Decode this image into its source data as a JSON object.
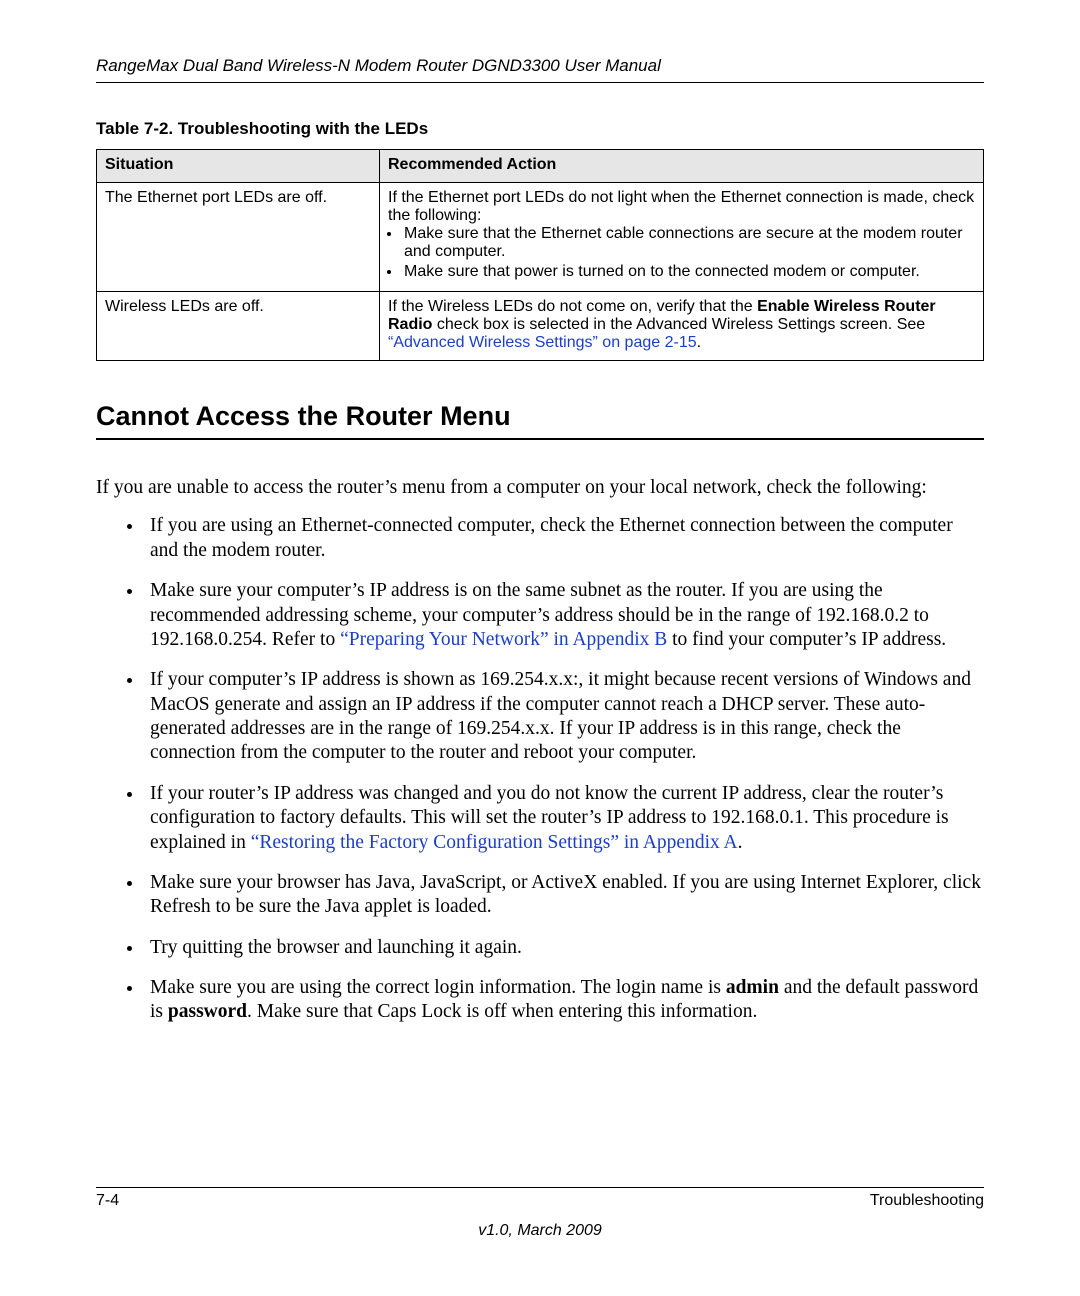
{
  "header": {
    "running_head": "RangeMax Dual Band Wireless-N Modem Router DGND3300 User Manual"
  },
  "table": {
    "caption": "Table 7-2.   Troubleshooting with the LEDs",
    "col1": "Situation",
    "col2": "Recommended Action",
    "rows": [
      {
        "situation": "The Ethernet port LEDs are off.",
        "action_intro": "If the Ethernet port LEDs do not light when the Ethernet connection is made, check the following:",
        "bullets": [
          "Make sure that the Ethernet cable connections are secure at the modem router and computer.",
          "Make sure that power is turned on to the connected modem or computer."
        ]
      },
      {
        "situation": "Wireless LEDs are off.",
        "action_pre": "If the Wireless LEDs do not come on, verify that the ",
        "action_bold": "Enable Wireless Router Radio",
        "action_mid": " check box is selected in the Advanced Wireless Settings screen. See ",
        "action_link": "“Advanced Wireless Settings” on page 2-15",
        "action_end": "."
      }
    ]
  },
  "section": {
    "heading": "Cannot Access the Router Menu",
    "intro": "If you are unable to access the router’s menu from a computer on your local network, check the following:",
    "items": [
      {
        "text": "If you are using an Ethernet-connected computer, check the Ethernet connection between the computer and the modem router."
      },
      {
        "pre": "Make sure your computer’s IP address is on the same subnet as the router. If you are using the recommended addressing scheme, your computer’s address should be in the range of 192.168.0.2 to 192.168.0.254. Refer to ",
        "link": "“Preparing Your Network” in Appendix B",
        "post": " to find your computer’s IP address."
      },
      {
        "text": "If your computer’s IP address is shown as 169.254.x.x:, it might because recent versions of Windows and MacOS generate and assign an IP address if the computer cannot reach a DHCP server. These auto-generated addresses are in the range of 169.254.x.x. If your IP address is in this range, check the connection from the computer to the router and reboot your computer."
      },
      {
        "pre": "If your router’s IP address was changed and you do not know the current IP address, clear the router’s configuration to factory defaults. This will set the router’s IP address to 192.168.0.1. This procedure is explained in ",
        "link": "“Restoring the Factory Configuration Settings” in Appendix A",
        "post": "."
      },
      {
        "text": "Make sure your browser has Java, JavaScript, or ActiveX enabled. If you are using Internet Explorer, click Refresh to be sure the Java applet is loaded."
      },
      {
        "text": "Try quitting the browser and launching it again."
      },
      {
        "pre": "Make sure you are using the correct login information. The login name is ",
        "bold1": "admin",
        "mid": " and the default password is ",
        "bold2": "password",
        "post": ". Make sure that Caps Lock is off when entering this information."
      }
    ]
  },
  "footer": {
    "left": "7-4",
    "right": "Troubleshooting",
    "version": "v1.0, March 2009"
  }
}
